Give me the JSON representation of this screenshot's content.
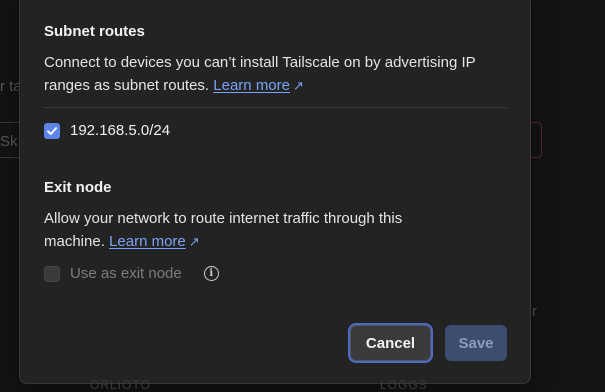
{
  "background": {
    "fragments": [
      "r ta",
      "Sk",
      "r",
      "ORLIOTO",
      "LOGGS"
    ]
  },
  "subnet_routes": {
    "title": "Subnet routes",
    "description": "Connect to devices you can’t install Tailscale on by advertising IP ranges as subnet routes.",
    "learn_more": "Learn more",
    "routes": [
      {
        "label": "192.168.5.0/24",
        "checked": true
      }
    ]
  },
  "exit_node": {
    "title": "Exit node",
    "description": "Allow your network to route internet traffic through this machine.",
    "learn_more": "Learn more",
    "checkbox_label": "Use as exit node",
    "checked": false,
    "disabled": true
  },
  "buttons": {
    "cancel": "Cancel",
    "save": "Save"
  },
  "colors": {
    "accent": "#5b85e8",
    "link": "#7aa3f5",
    "dialog_bg": "#232324"
  }
}
